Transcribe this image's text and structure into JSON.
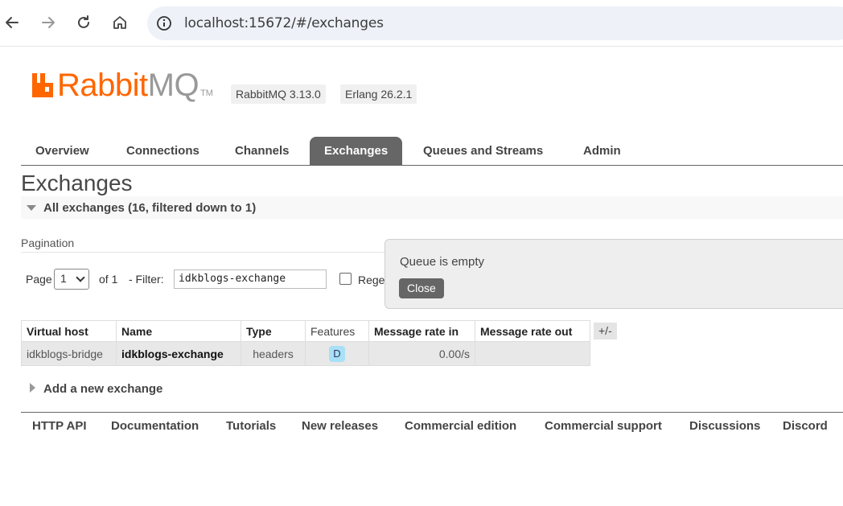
{
  "browser": {
    "url": "localhost:15672/#/exchanges"
  },
  "header": {
    "logo_rabbit": "Rabbit",
    "logo_mq": "MQ",
    "logo_tm": "TM",
    "rabbitmq_version": "RabbitMQ 3.13.0",
    "erlang_version": "Erlang 26.2.1",
    "brand_color": "#ff6600"
  },
  "tabs": [
    {
      "label": "Overview",
      "active": false
    },
    {
      "label": "Connections",
      "active": false
    },
    {
      "label": "Channels",
      "active": false
    },
    {
      "label": "Exchanges",
      "active": true
    },
    {
      "label": "Queues and Streams",
      "active": false
    },
    {
      "label": "Admin",
      "active": false
    }
  ],
  "page": {
    "title": "Exchanges",
    "section_label": "All exchanges (16, filtered down to 1)",
    "pagination_label": "Pagination",
    "page_label": "Page",
    "page_value": "1",
    "of_label": "of 1",
    "filter_label": "- Filter:",
    "filter_value": "idkblogs-exchange",
    "regex_label": "Rege"
  },
  "popup": {
    "message": "Queue is empty",
    "close_label": "Close"
  },
  "table": {
    "headers": [
      "Virtual host",
      "Name",
      "Type",
      "Features",
      "Message rate in",
      "Message rate out"
    ],
    "plus_minus": "+/-",
    "rows": [
      {
        "vhost": "idkblogs-bridge",
        "name": "idkblogs-exchange",
        "type": "headers",
        "feature": "D",
        "rate_in": "0.00/s",
        "rate_out": ""
      }
    ]
  },
  "add_exchange": "Add a new exchange",
  "footer": [
    "HTTP API",
    "Documentation",
    "Tutorials",
    "New releases",
    "Commercial edition",
    "Commercial support",
    "Discussions",
    "Discord"
  ]
}
